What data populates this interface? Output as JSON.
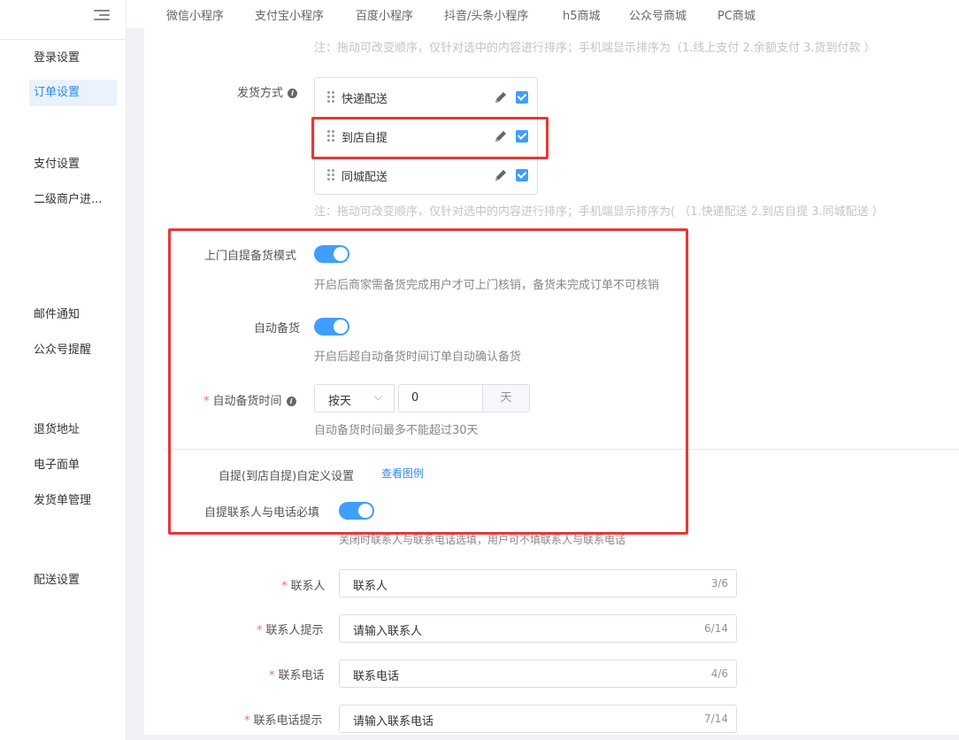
{
  "sidebar": {
    "items": [
      {
        "label": "登录设置"
      },
      {
        "label": "订单设置"
      },
      {
        "label": "支付设置"
      },
      {
        "label": "二级商户进..."
      },
      {
        "label": "邮件通知"
      },
      {
        "label": "公众号提醒"
      },
      {
        "label": "退货地址"
      },
      {
        "label": "电子面单"
      },
      {
        "label": "发货单管理"
      },
      {
        "label": "配送设置"
      }
    ],
    "active_index": 1
  },
  "topnav": {
    "tabs": [
      {
        "label": "微信小程序"
      },
      {
        "label": "支付宝小程序"
      },
      {
        "label": "百度小程序"
      },
      {
        "label": "抖音/头条小程序"
      },
      {
        "label": "h5商城"
      },
      {
        "label": "公众号商城"
      },
      {
        "label": "PC商城"
      }
    ]
  },
  "payment": {
    "note": "注：拖动可改变顺序，仅针对选中的内容进行排序；手机端显示排序为（1.线上支付 2.余额支付 3.货到付款 ）"
  },
  "delivery": {
    "label": "发货方式",
    "items": [
      {
        "label": "快递配送",
        "checked": true
      },
      {
        "label": "到店自提",
        "checked": true
      },
      {
        "label": "同城配送",
        "checked": true
      }
    ],
    "note": "注：拖动可改变顺序，仅针对选中的内容进行排序；手机端显示排序为( （1.快递配送 2.到店自提 3.同城配送 ）"
  },
  "pickup_prep": {
    "label": "上门自提备货模式",
    "enabled": true,
    "desc": "开启后商家需备货完成用户才可上门核销，备货未完成订单不可核销"
  },
  "auto_prep": {
    "label": "自动备货",
    "enabled": true,
    "desc": "开启后超自动备货时间订单自动确认备货"
  },
  "auto_prep_time": {
    "label": "自动备货时间",
    "select_value": "按天",
    "input_value": "0",
    "unit": "天",
    "desc": "自动备货时间最多不能超过30天"
  },
  "custom": {
    "label": "自提(到店自提)自定义设置",
    "link": "查看图例"
  },
  "contact_required": {
    "label": "自提联系人与电话必填",
    "enabled": true,
    "desc": "关闭时联系人与联系电话选填，用户可不填联系人与联系电话"
  },
  "fields": [
    {
      "label": "联系人",
      "value": "联系人",
      "count": "3/6"
    },
    {
      "label": "联系人提示",
      "value": "请输入联系人",
      "count": "6/14"
    },
    {
      "label": "联系电话",
      "value": "联系电话",
      "count": "4/6"
    },
    {
      "label": "联系电话提示",
      "value": "请输入联系电话",
      "count": "7/14"
    }
  ],
  "colors": {
    "accent": "#409eff",
    "highlight": "#e53935",
    "required": "#f56c6c"
  }
}
